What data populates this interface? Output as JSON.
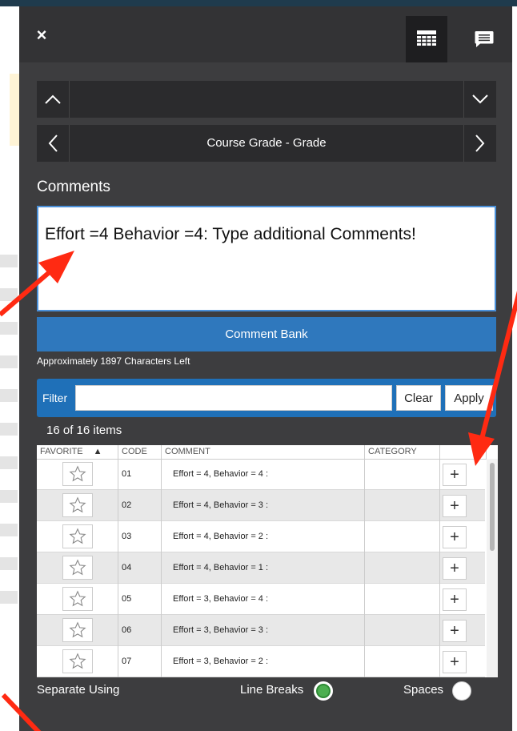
{
  "panel": {
    "close_label": "×",
    "grid_icon": "grid-icon",
    "comment_icon": "comment-icon"
  },
  "navigation": {
    "row1_label": "",
    "row2_label": "Course Grade - Grade"
  },
  "comments": {
    "heading": "Comments",
    "text": "Effort =4 Behavior =4: Type additional Comments!",
    "comment_bank_label": "Comment Bank",
    "chars_left": "Approximately 1897 Characters Left"
  },
  "filter": {
    "label": "Filter",
    "value": "",
    "placeholder": "",
    "clear_label": "Clear",
    "apply_label": "Apply"
  },
  "items_count": "16 of 16 items",
  "table": {
    "headers": {
      "favorite": "FAVORITE",
      "sort_icon": "▲",
      "code": "CODE",
      "comment": "COMMENT",
      "category": "CATEGORY"
    },
    "rows": [
      {
        "code": "01",
        "comment": "Effort = 4, Behavior = 4 :",
        "category": ""
      },
      {
        "code": "02",
        "comment": "Effort = 4, Behavior = 3 :",
        "category": ""
      },
      {
        "code": "03",
        "comment": "Effort = 4, Behavior = 2 :",
        "category": ""
      },
      {
        "code": "04",
        "comment": "Effort = 4, Behavior = 1 :",
        "category": ""
      },
      {
        "code": "05",
        "comment": "Effort = 3, Behavior = 4 :",
        "category": ""
      },
      {
        "code": "06",
        "comment": "Effort = 3, Behavior = 3 :",
        "category": ""
      },
      {
        "code": "07",
        "comment": "Effort = 3, Behavior = 2 :",
        "category": ""
      }
    ],
    "add_label": "+"
  },
  "separate": {
    "label": "Separate Using",
    "line_breaks_label": "Line Breaks",
    "spaces_label": "Spaces",
    "selected": "Line Breaks"
  },
  "colors": {
    "panel_bg": "#3d3d3f",
    "accent_blue": "#2f78bd",
    "annotation_red": "#ff2a12",
    "radio_green": "#4caf50"
  }
}
